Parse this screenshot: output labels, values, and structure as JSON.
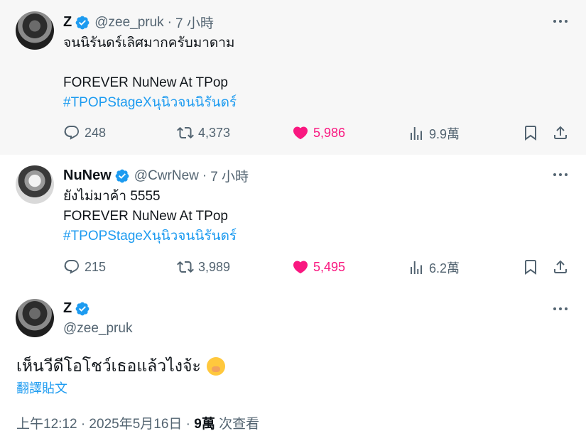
{
  "tweets": [
    {
      "name": "Z",
      "handle": "@zee_pruk",
      "separator": "·",
      "time": "7 小時",
      "lines": [
        "จนนิรันดร์เลิศมากครับมาดาม",
        "",
        "FOREVER NuNew At TPop"
      ],
      "hashtag": "#TPOPStageXนุนิวจนนิรันดร์",
      "replies": "248",
      "retweets": "4,373",
      "likes": "5,986",
      "views": "9.9萬"
    },
    {
      "name": "NuNew",
      "handle": "@CwrNew",
      "separator": "·",
      "time": "7 小時",
      "lines": [
        "ยังไม่มาค้า 5555",
        "FOREVER NuNew At TPop"
      ],
      "hashtag": "#TPOPStageXนุนิวจนนิรันดร์",
      "replies": "215",
      "retweets": "3,989",
      "likes": "5,495",
      "views": "6.2萬"
    }
  ],
  "main": {
    "name": "Z",
    "handle": "@zee_pruk",
    "text": "เห็นวีดีโอโชว์เธอแล้วไงจ้ะ",
    "emoji": "face-with-hand-over-mouth",
    "translate": "翻譯貼文",
    "timestamp": "上午12:12 · 2025年5月16日 · ",
    "views_count": "9萬",
    "views_label": " 次查看"
  },
  "colors": {
    "accent": "#1d9bf0",
    "like": "#f91880",
    "muted": "#536471"
  }
}
